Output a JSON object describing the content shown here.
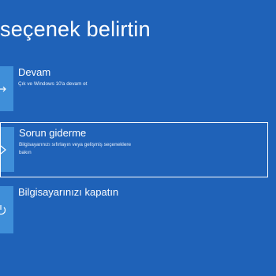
{
  "page": {
    "title": "seçenek belirtin"
  },
  "options": [
    {
      "title": "Devam",
      "description": "Çık ve Windows 10'a devam et",
      "icon": "arrow-right-icon",
      "selected": false
    },
    {
      "title": "Sorun giderme",
      "description": "Bilgisayarınızı sıfırlayın veya gelişmiş seçeneklere bakın",
      "icon": "tools-icon",
      "selected": true
    },
    {
      "title": "Bilgisayarınızı kapatın",
      "description": "",
      "icon": "power-icon",
      "selected": false
    }
  ],
  "colors": {
    "background": "#1f62b8",
    "tile": "#3f8fd9",
    "text": "#ffffff"
  }
}
